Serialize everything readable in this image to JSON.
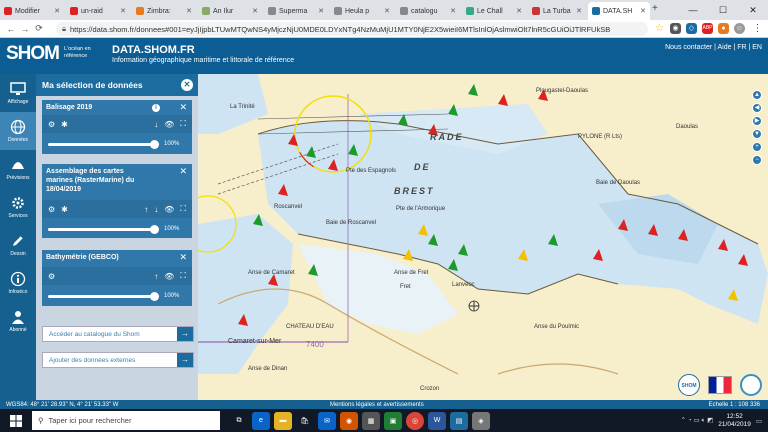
{
  "browser": {
    "tabs": [
      {
        "label": "Modifier",
        "color": "#d22"
      },
      {
        "label": "un-raid",
        "color": "#d22"
      },
      {
        "label": "Zimbra:",
        "color": "#e87b1e"
      },
      {
        "label": "An Ilur",
        "color": "#8a6"
      },
      {
        "label": "Superma",
        "color": "#888"
      },
      {
        "label": "Heula p",
        "color": "#888"
      },
      {
        "label": "catalogu",
        "color": "#888"
      },
      {
        "label": "Le Chall",
        "color": "#3a8"
      },
      {
        "label": "La Turba",
        "color": "#c33"
      },
      {
        "label": "DATA.SH",
        "color": "#1d6ca0"
      }
    ],
    "url": "https://data.shom.fr/donnees#001=eyJjIjpbLTUwMTQwNS4yMjczNjU0MDE0LDYxNTg4NzMuMjU1MTY0NjE2X5wieiI6MTlsInlOjAslmwiOlt7lnR5cGUiOiJTlRFUkSB",
    "new_tab": "+",
    "back": "←",
    "forward": "→",
    "reload": "⟳"
  },
  "header": {
    "logo": "SHOM",
    "logo_tag": "L'océan en référence",
    "title": "DATA.SHOM.FR",
    "subtitle": "Information géographique maritime et littorale de référence",
    "links": "Nous contacter | Aide | FR | EN"
  },
  "sidebar": {
    "items": [
      {
        "label": "Affichage",
        "icon": "monitor-icon"
      },
      {
        "label": "Données",
        "icon": "globe-icon"
      },
      {
        "label": "Prévisions",
        "icon": "wave-icon"
      },
      {
        "label": "Services",
        "icon": "gear-icon"
      },
      {
        "label": "Dessin",
        "icon": "pencil-icon"
      },
      {
        "label": "Infoséco",
        "icon": "info-icon"
      },
      {
        "label": "Abonné",
        "icon": "user-icon"
      }
    ]
  },
  "panel": {
    "title": "Ma sélection de données",
    "layers": [
      {
        "name": "Balisage 2019",
        "opacity": "100%"
      },
      {
        "name": "Assemblage des cartes marines (RasterMarine) du 18/04/2019",
        "opacity": "100%"
      },
      {
        "name": "Bathymétrie (GEBCO)",
        "opacity": "100%"
      }
    ],
    "catalog_button": "Accéder au catalogue du Shom",
    "external_button": "Ajouter des données externes"
  },
  "map": {
    "labels": {
      "rade": "RADE",
      "de": "DE",
      "brest": "BREST",
      "baie_daoulas": "Baie de Daoulas",
      "daoulas": "Daoulas",
      "plougastel": "Plougastel-Daoulas",
      "camaret": "Camaret-sur-Mer",
      "chateau": "CHATEAU D'EAU",
      "roscanvel": "Roscanvel",
      "baie_roscanvel": "Baie de Roscanvel",
      "anse_poulmic": "Anse du Poulmic",
      "anse_fret": "Anse de Fret",
      "anse_camaret": "Anse de Camaret",
      "anse_dinan": "Anse de Dinan",
      "trinite": "La Trinité",
      "espagnols": "Pte des Espagnols",
      "armorique": "Pte de l'Armorique",
      "lanveoc": "Lanvéoc",
      "crozon": "Crozon",
      "pylone": "PYLONE (R Lts)",
      "chart_number": "7400",
      "fret": "Fret"
    }
  },
  "status": {
    "coords": "WGS84: 48° 21' 28.93\" N, 4° 21' 53.33\" W",
    "legal": "Mentions légales et avertissements",
    "scale": "Echelle 1 : 108 336"
  },
  "taskbar": {
    "search_placeholder": "Taper ici pour rechercher",
    "time": "12:52",
    "date": "21/04/2019"
  }
}
